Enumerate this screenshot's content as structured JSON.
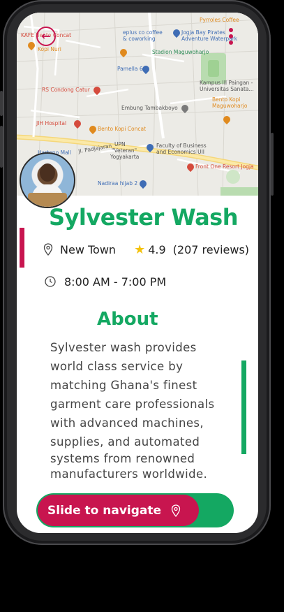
{
  "business": {
    "name": "Sylvester Wash",
    "location": "New Town",
    "rating": "4.9",
    "reviews": "(207 reviews)",
    "hours": "8:00 AM - 7:00 PM"
  },
  "about": {
    "heading": "About",
    "lines": [
      "Sylvester wash provides",
      "world class service by",
      "matching Ghana's finest",
      "garment care professionals",
      "with advanced machines,",
      "supplies, and automated",
      "systems from renowned",
      "manufacturers worldwide."
    ]
  },
  "slider": {
    "label": "Slide to navigate"
  },
  "map": {
    "labels": {
      "pyrroles": "Pyrroles Coffee",
      "kafe": "KAFE Bento Concat",
      "eplus": "eplus co coffee",
      "coworking": "& coworking",
      "jogja": "Jogja Bay Pirates",
      "jogja2": "Adventure Waterpark",
      "stadion": "Stadion Maguwoharjo",
      "kopi_nuri": "Kopi Nuri",
      "pamella": "Pamella 6",
      "rs_condong": "RS Condong Catur",
      "kampus": "Kampus III Paingan -",
      "kampus2": "Universitas Sanata...",
      "bento_kopi_right": "Bento Kopi",
      "maguwoharjo": "Maguwoharjo",
      "embung": "Embung Tambakboyo",
      "jih": "JIH Hospital",
      "bento_kopi_mid": "Bento Kopi Concat",
      "hartono": "Hartono Mall",
      "upn": "UPN",
      "veteran": "\"Veteran\"",
      "yogyakarta": "Yogyakarta",
      "faculty": "Faculty of Business",
      "faculty2": "and Economics UII",
      "front_one": "Front One Resort Jogja",
      "nadiraa": "Nadiraa hijab 2",
      "jl_padjajaran": "Jl. Padjajaran",
      "marriott": "rriott"
    }
  },
  "colors": {
    "brand_green": "#14a862",
    "brand_crimson": "#c8154f",
    "star": "#f4c20d"
  },
  "icons": {
    "back": "back-arrow-icon",
    "menu": "vertical-dots-icon",
    "location": "map-pin-icon",
    "rating": "star-icon",
    "hours": "clock-icon",
    "navigate": "map-pin-icon"
  }
}
